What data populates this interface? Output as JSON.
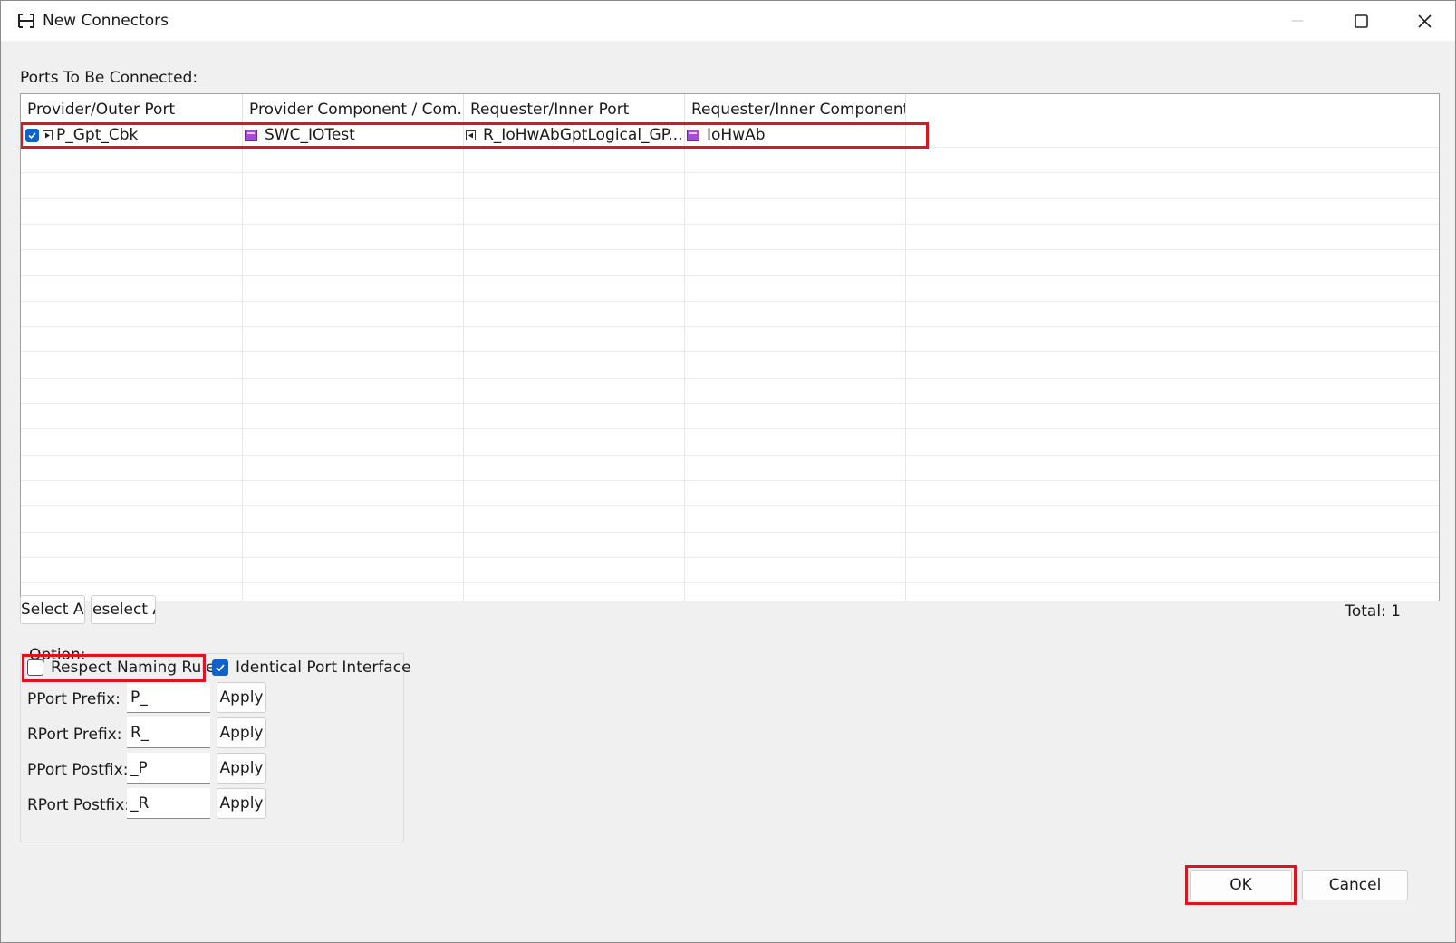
{
  "window": {
    "title": "New Connectors",
    "icon": "connector-icon"
  },
  "ports_label": "Ports To Be Connected:",
  "table": {
    "columns": [
      "Provider/Outer Port",
      "Provider Component / Com...",
      "Requester/Inner Port",
      "Requester/Inner Component"
    ],
    "rows": [
      {
        "checked": true,
        "provider_port": "P_Gpt_Cbk",
        "provider_component": "SWC_IOTest",
        "requester_port": "R_IoHwAbGptLogical_GP...",
        "requester_component": "IoHwAb"
      }
    ]
  },
  "buttons": {
    "select_all": "Select Al",
    "deselect_all": "eselect A",
    "ok": "OK",
    "cancel": "Cancel"
  },
  "total_label": "Total: 1",
  "option": {
    "label": "Option:",
    "respect_naming_rule": {
      "label": "Respect Naming Rule",
      "checked": false
    },
    "identical_port_interface": {
      "label": "Identical Port Interface",
      "checked": true
    },
    "fields": [
      {
        "label": "PPort Prefix:",
        "value": "P_",
        "apply": "Apply"
      },
      {
        "label": "RPort Prefix:",
        "value": "R_",
        "apply": "Apply"
      },
      {
        "label": "PPort Postfix:",
        "value": "_P",
        "apply": "Apply"
      },
      {
        "label": "RPort Postfix:",
        "value": "_R",
        "apply": "Apply"
      }
    ]
  },
  "colors": {
    "highlight": "#e0141e",
    "checkbox_accent": "#0f62c8",
    "component_icon": "#a64bd6"
  }
}
